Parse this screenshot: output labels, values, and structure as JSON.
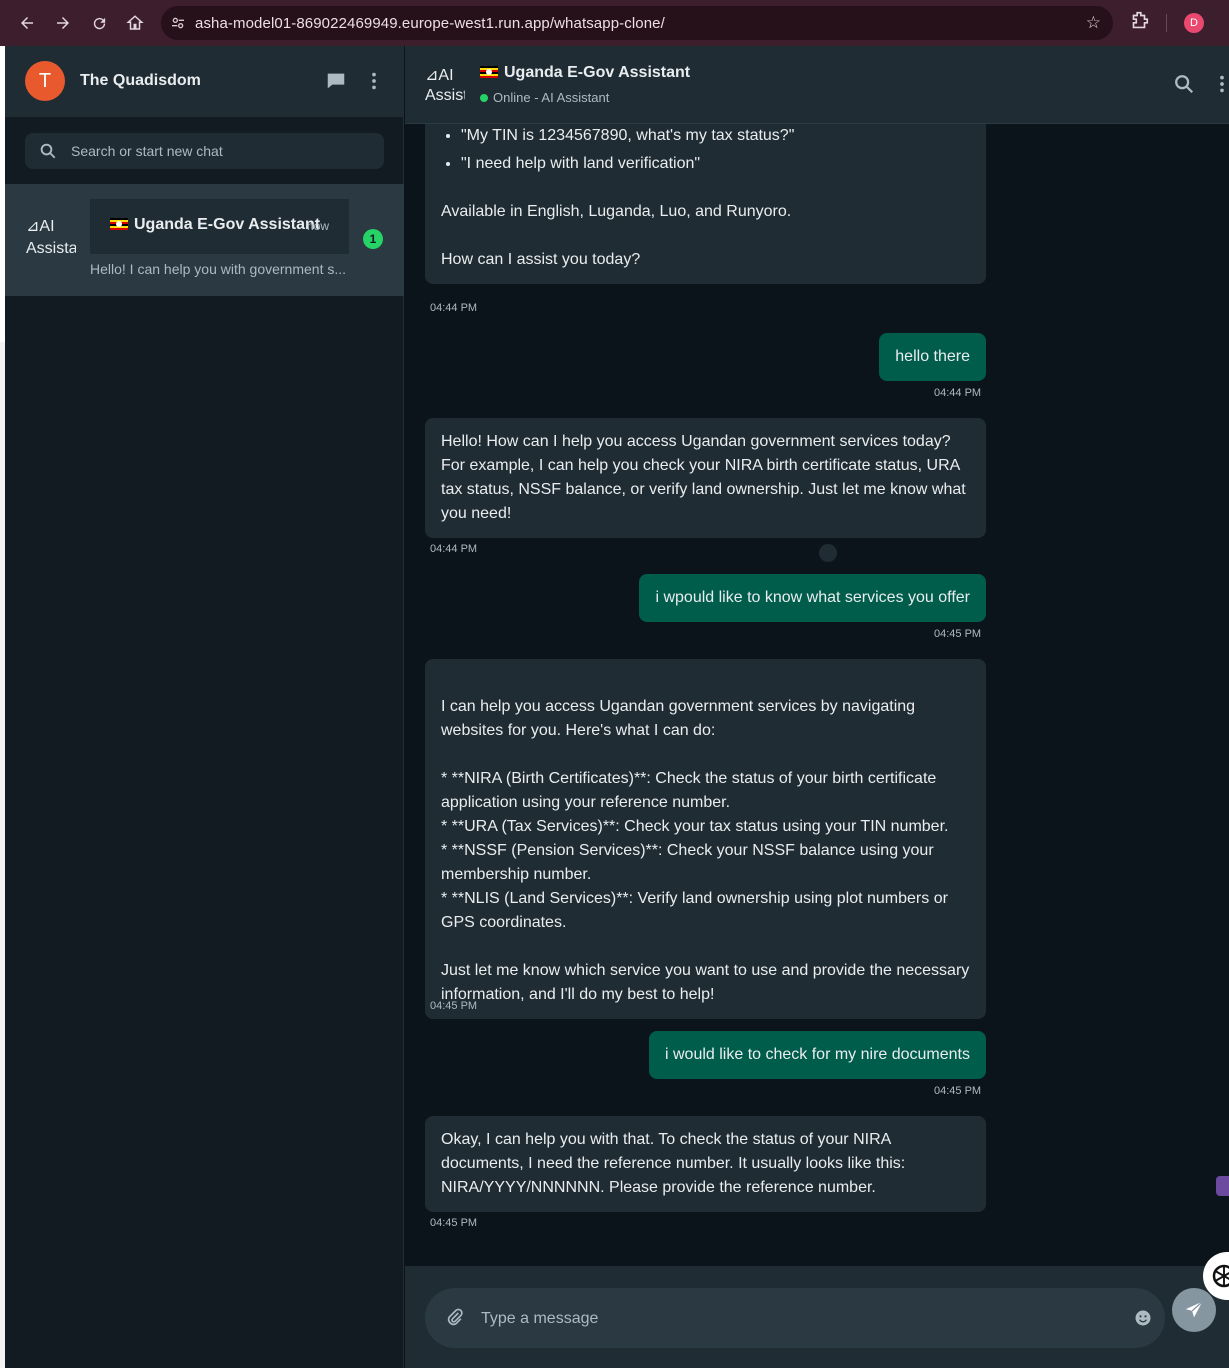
{
  "browser": {
    "url": "asha-model01-869022469949.europe-west1.run.app/whatsapp-clone/",
    "profile_initial": "D"
  },
  "sidebar": {
    "user_initial": "T",
    "title": "The Quadisdom",
    "search_placeholder": "Search or start new chat",
    "chats": [
      {
        "avatar_alt": "AI Assistant",
        "name": "Uganda E-Gov Assistant",
        "time": "now",
        "preview": "Hello! I can help you with government s...",
        "unread": "1"
      }
    ]
  },
  "conversation": {
    "avatar_alt": "AI Assistant",
    "title": "Uganda E-Gov Assistant",
    "status": "Online - AI Assistant",
    "messages": [
      {
        "direction": "incoming",
        "list_items": [
          "\"My TIN is 1234567890, what's my tax status?\"",
          "\"I need help with land verification\""
        ],
        "text": "Available in English, Luganda, Luo, and Runyoro.\n\nHow can I assist you today?",
        "time": "04:44 PM"
      },
      {
        "direction": "outgoing",
        "text": "hello there",
        "time": "04:44 PM"
      },
      {
        "direction": "incoming",
        "text": "Hello! How can I help you access Ugandan government services today? For example, I can help you check your NIRA birth certificate status, URA tax status, NSSF balance, or verify land ownership. Just let me know what you need!",
        "time": "04:44 PM"
      },
      {
        "direction": "outgoing",
        "text": "i wpould like to know what services you offer",
        "time": "04:45 PM"
      },
      {
        "direction": "incoming",
        "text": "I can help you access Ugandan government services by navigating websites for you. Here's what I can do:\n\n* **NIRA (Birth Certificates)**: Check the status of your birth certificate application using your reference number.\n* **URA (Tax Services)**: Check your tax status using your TIN number.\n* **NSSF (Pension Services)**: Check your NSSF balance using your membership number.\n* **NLIS (Land Services)**: Verify land ownership using plot numbers or GPS coordinates.\n\nJust let me know which service you want to use and provide the necessary information, and I'll do my best to help!",
        "time": "04:45 PM"
      },
      {
        "direction": "outgoing",
        "text": "i would like to check for my nire documents",
        "time": "04:45 PM"
      },
      {
        "direction": "incoming",
        "text": "Okay, I can help you with that. To check the status of your NIRA documents, I need the reference number. It usually looks like this: NIRA/YYYY/NNNNNN. Please provide the reference number.",
        "time": "04:45 PM"
      }
    ]
  },
  "composer": {
    "placeholder": "Type a message"
  },
  "colors": {
    "incoming_bubble": "#202c33",
    "outgoing_bubble": "#005c4b",
    "online": "#25d366",
    "avatar": "#e85a2e"
  }
}
